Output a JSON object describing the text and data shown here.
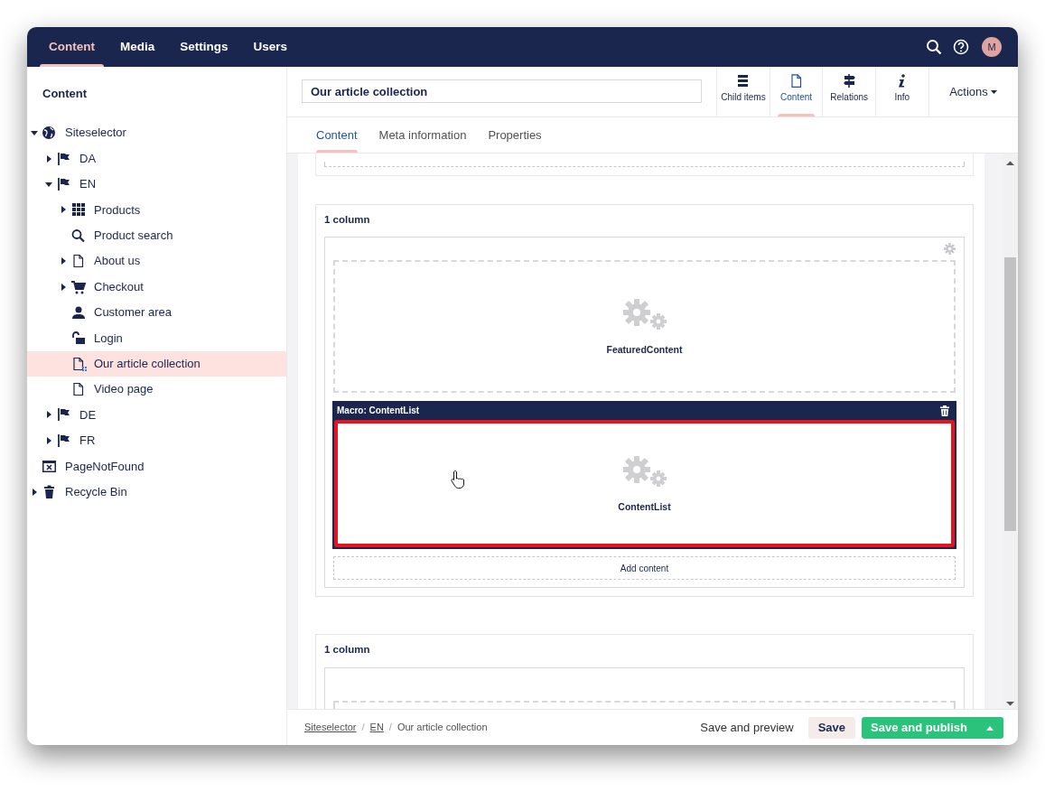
{
  "top_nav": {
    "sections": [
      {
        "label": "Content",
        "selected": true
      },
      {
        "label": "Media",
        "selected": false
      },
      {
        "label": "Settings",
        "selected": false
      },
      {
        "label": "Users",
        "selected": false
      }
    ],
    "avatar": "M"
  },
  "sidebar": {
    "title": "Content",
    "tree": [
      {
        "label": "Siteselector",
        "kind": "site",
        "expanded": true,
        "selected": false,
        "children": [
          {
            "label": "DA",
            "kind": "language",
            "expanded": false,
            "selected": false
          },
          {
            "label": "EN",
            "kind": "language",
            "expanded": true,
            "selected": false,
            "children": [
              {
                "label": "Products",
                "kind": "listing",
                "expanded": false,
                "selected": false
              },
              {
                "label": "Product search",
                "kind": "search",
                "selected": false
              },
              {
                "label": "About us",
                "kind": "page",
                "expanded": false,
                "selected": false
              },
              {
                "label": "Checkout",
                "kind": "cart",
                "expanded": false,
                "selected": false
              },
              {
                "label": "Customer area",
                "kind": "member",
                "selected": false
              },
              {
                "label": "Login",
                "kind": "login",
                "selected": false
              },
              {
                "label": "Our article collection",
                "kind": "collection",
                "selected": true
              },
              {
                "label": "Video page",
                "kind": "page",
                "selected": false
              }
            ]
          },
          {
            "label": "DE",
            "kind": "language",
            "expanded": false,
            "selected": false
          },
          {
            "label": "FR",
            "kind": "language",
            "expanded": false,
            "selected": false
          }
        ]
      },
      {
        "label": "PageNotFound",
        "kind": "error-page",
        "selected": false
      },
      {
        "label": "Recycle Bin",
        "kind": "bin",
        "expanded": false,
        "selected": false
      }
    ]
  },
  "header": {
    "node_name": "Our article collection",
    "apps": [
      {
        "label": "Child items",
        "kind": "list",
        "selected": false
      },
      {
        "label": "Content",
        "kind": "document",
        "selected": true
      },
      {
        "label": "Relations",
        "kind": "signpost",
        "selected": false
      },
      {
        "label": "Info",
        "kind": "info",
        "selected": false
      }
    ],
    "actions": "Actions"
  },
  "tabs": [
    {
      "label": "Content",
      "selected": true
    },
    {
      "label": "Meta information",
      "selected": false
    },
    {
      "label": "Properties",
      "selected": false
    }
  ],
  "grid_rows": [
    {
      "title": "1 column",
      "controls": [
        {
          "label": "FeaturedContent",
          "selected": false
        },
        {
          "header": "Macro: ContentList",
          "label": "ContentList",
          "selected": true
        }
      ],
      "add_label": "Add content"
    },
    {
      "title": "1 column"
    }
  ],
  "footer": {
    "separators": [
      "/",
      "/"
    ],
    "breadcrumb": [
      {
        "label": "Siteselector",
        "link": true
      },
      {
        "label": "EN",
        "link": true
      },
      {
        "label": "Our article collection",
        "link": false
      }
    ],
    "preview": "Save and preview",
    "save": "Save",
    "publish": "Save and publish"
  }
}
